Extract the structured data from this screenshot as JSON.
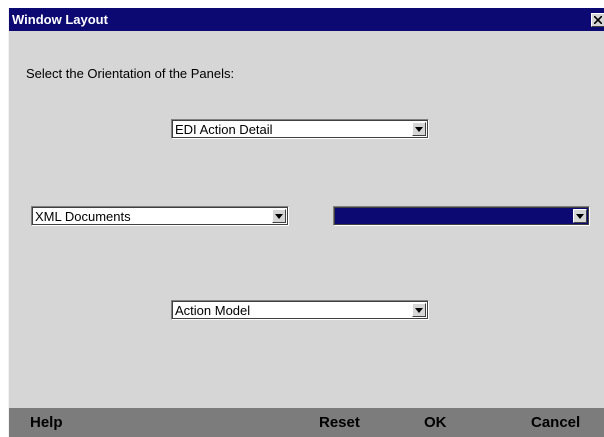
{
  "dialog": {
    "title": "Window Layout",
    "prompt": "Select the Orientation of the Panels:"
  },
  "panels": {
    "top": {
      "value": "EDI Action Detail"
    },
    "left": {
      "value": "XML Documents"
    },
    "right": {
      "value": ""
    },
    "bottom": {
      "value": "Action Model"
    }
  },
  "footer": {
    "help_label": "Help",
    "reset_label": "Reset",
    "ok_label": "OK",
    "cancel_label": "Cancel"
  },
  "colors": {
    "titlebar": "#0c0a72",
    "selection": "#0c0a72",
    "dialog_bg": "#d6d6d6",
    "footer_bg": "#7c7c7c"
  },
  "icons": {
    "close": "close-icon",
    "dropdown": "chevron-down-icon"
  }
}
